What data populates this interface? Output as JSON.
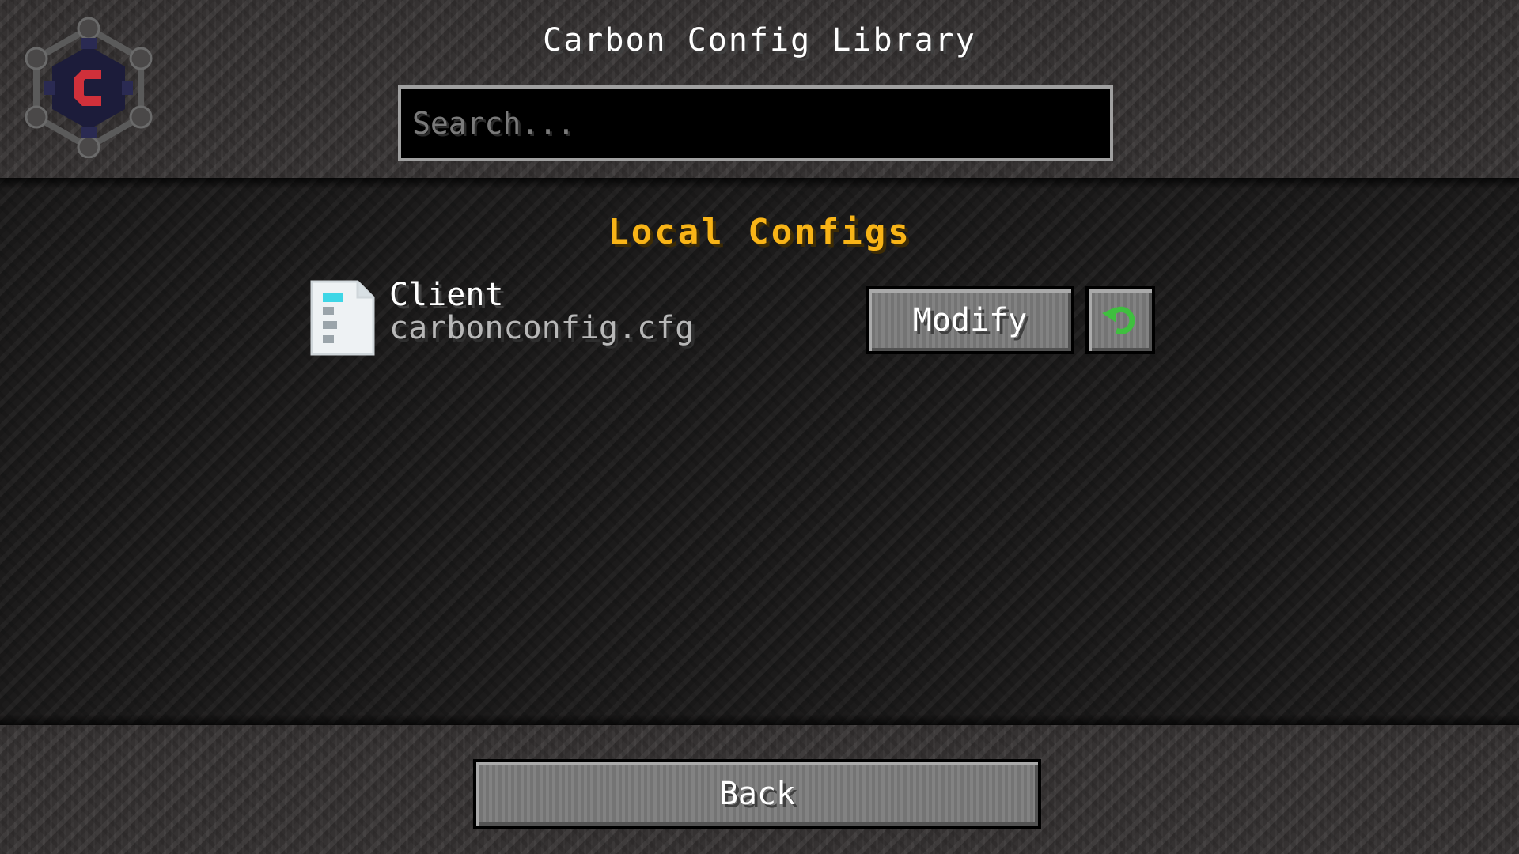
{
  "header": {
    "title": "Carbon Config Library",
    "logo_icon": "carbon-config-logo-icon"
  },
  "search": {
    "placeholder": "Search...",
    "value": ""
  },
  "section": {
    "title": "Local Configs",
    "title_color": "#f8b417"
  },
  "configs": [
    {
      "name": "Client",
      "file": "carbonconfig.cfg",
      "icon": "config-file-icon",
      "modify_label": "Modify",
      "reset_icon": "undo-arrow-icon",
      "reset_icon_color": "#3fbf3f"
    }
  ],
  "footer": {
    "back_label": "Back"
  }
}
